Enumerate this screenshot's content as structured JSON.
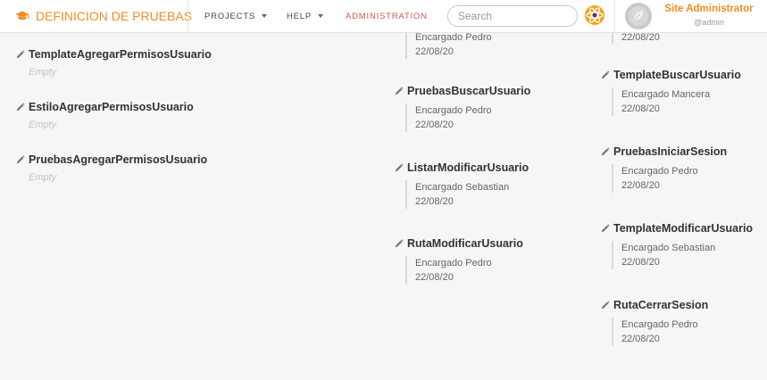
{
  "nav": {
    "brand": "DEFINICION DE PRUEBAS",
    "projects": "PROJECTS",
    "help": "HELP",
    "administration": "ADMINISTRATION",
    "search_placeholder": "Search",
    "user_name": "Site Administrator",
    "user_handle": "@admin",
    "brand_icon": "graduation-cap-icon",
    "logo_icon": "atom-logo-icon",
    "colors": {
      "accent": "#f18d24",
      "admin": "#d9534f"
    }
  },
  "left_items": [
    {
      "title": "TemplateAgregarPermisosUsuario",
      "status": "Empty"
    },
    {
      "title": "EstiloAgregarPermisosUsuario",
      "status": "Empty"
    },
    {
      "title": "PruebasAgregarPermisosUsuario",
      "status": "Empty"
    }
  ],
  "middle_top": {
    "owner": "Encargado Pedro",
    "date": "22/08/20"
  },
  "middle_items": [
    {
      "title": "PruebasBuscarUsuario",
      "owner": "Encargado Pedro",
      "date": "22/08/20"
    },
    {
      "title": "ListarModificarUsuario",
      "owner": "Encargado Sebastian",
      "date": "22/08/20"
    },
    {
      "title": "RutaModificarUsuario",
      "owner": "Encargado Pedro",
      "date": "22/08/20"
    }
  ],
  "right_top": {
    "date": "22/08/20"
  },
  "right_items": [
    {
      "title": "TemplateBuscarUsuario",
      "owner": "Encargado Mancera",
      "date": "22/08/20"
    },
    {
      "title": "PruebasIniciarSesion",
      "owner": "Encargado Pedro",
      "date": "22/08/20"
    },
    {
      "title": "TemplateModificarUsuario",
      "owner": "Encargado Sebastian",
      "date": "22/08/20"
    },
    {
      "title": "RutaCerrarSesion",
      "owner": "Encargado Pedro",
      "date": "22/08/20"
    }
  ]
}
